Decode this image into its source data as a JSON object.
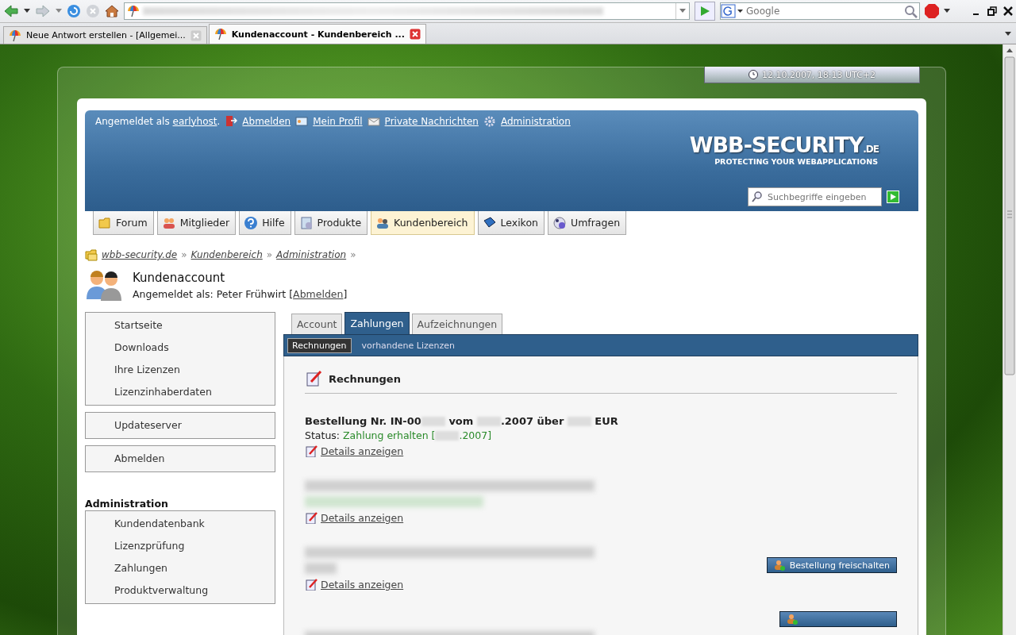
{
  "browser": {
    "search": {
      "placeholder": "Google"
    },
    "tabs": [
      {
        "title": "Neue Antwort erstellen - [Allgemei...",
        "selected": false
      },
      {
        "title": "Kundenaccount - Kundenbereich ...",
        "selected": true
      }
    ]
  },
  "clock": {
    "text": "12.10.2007, 18:13 UTC+2"
  },
  "header": {
    "greeting": "Angemeldet als",
    "user": "earlyhost",
    "after_user": ".",
    "links": [
      {
        "label": "Abmelden"
      },
      {
        "label": "Mein Profil"
      },
      {
        "label": "Private Nachrichten"
      },
      {
        "label": "Administration"
      }
    ],
    "logo": {
      "title": "WBB-SECURITY",
      "suffix": ".DE",
      "tagline": "PROTECTING YOUR WEBAPPLICATIONS"
    },
    "search": {
      "placeholder": "Suchbegriffe eingeben"
    }
  },
  "nav": [
    {
      "label": "Forum",
      "selected": false
    },
    {
      "label": "Mitglieder",
      "selected": false
    },
    {
      "label": "Hilfe",
      "selected": false
    },
    {
      "label": "Produkte",
      "selected": false
    },
    {
      "label": "Kundenbereich",
      "selected": true
    },
    {
      "label": "Lexikon",
      "selected": false
    },
    {
      "label": "Umfragen",
      "selected": false
    }
  ],
  "breadcrumb": {
    "separator": "»",
    "items": [
      "wbb-security.de",
      "Kundenbereich",
      "Administration"
    ]
  },
  "page_title": {
    "title": "Kundenaccount",
    "subtitle_prefix": "Angemeldet als: Peter Frühwirt [",
    "subtitle_link": "Abmelden",
    "subtitle_suffix": "]"
  },
  "sidebar": {
    "groups": [
      {
        "items": [
          "Startseite",
          "Downloads",
          "Ihre Lizenzen",
          "Lizenzinhaberdaten"
        ]
      },
      {
        "items": [
          "Updateserver"
        ]
      },
      {
        "items": [
          "Abmelden"
        ]
      }
    ],
    "admin_heading": "Administration",
    "admin_items": [
      "Kundendatenbank",
      "Lizenzprüfung",
      "Zahlungen",
      "Produktverwaltung"
    ]
  },
  "tabs": [
    {
      "label": "Account",
      "selected": false
    },
    {
      "label": "Zahlungen",
      "selected": true
    },
    {
      "label": "Aufzeichnungen",
      "selected": false
    }
  ],
  "subtabs": [
    {
      "label": "Rechnungen",
      "selected": true
    },
    {
      "label": "vorhandene Lizenzen",
      "selected": false
    }
  ],
  "section_title": "Rechnungen",
  "orders": [
    {
      "lines": [
        [
          {
            "kind": "strong",
            "text": "Bestellung Nr. IN-00"
          },
          {
            "kind": "redacted"
          },
          {
            "kind": "strong",
            "text": " vom "
          },
          {
            "kind": "redacted"
          },
          {
            "kind": "strong",
            "text": ".2007 über "
          },
          {
            "kind": "redacted"
          },
          {
            "kind": "strong",
            "text": " EUR"
          }
        ],
        [
          {
            "kind": "plain",
            "text": "Status: "
          },
          {
            "kind": "status",
            "text": "Zahlung erhalten ["
          },
          {
            "kind": "redacted"
          },
          {
            "kind": "status",
            "text": ".2007]"
          }
        ]
      ],
      "details": "Details anzeigen"
    },
    {
      "lines": [
        [
          {
            "kind": "blur"
          }
        ],
        [
          {
            "kind": "blur_status"
          }
        ]
      ],
      "details": "Details anzeigen"
    },
    {
      "lines": [
        [
          {
            "kind": "blur"
          }
        ],
        [
          {
            "kind": "blur_short"
          }
        ]
      ],
      "details": "Details anzeigen",
      "action": {
        "kind": "unlock",
        "label": "Bestellung freischalten"
      }
    },
    {
      "lines": [
        [
          {
            "kind": "blur"
          }
        ]
      ],
      "action": {
        "kind": "unlock"
      }
    }
  ]
}
